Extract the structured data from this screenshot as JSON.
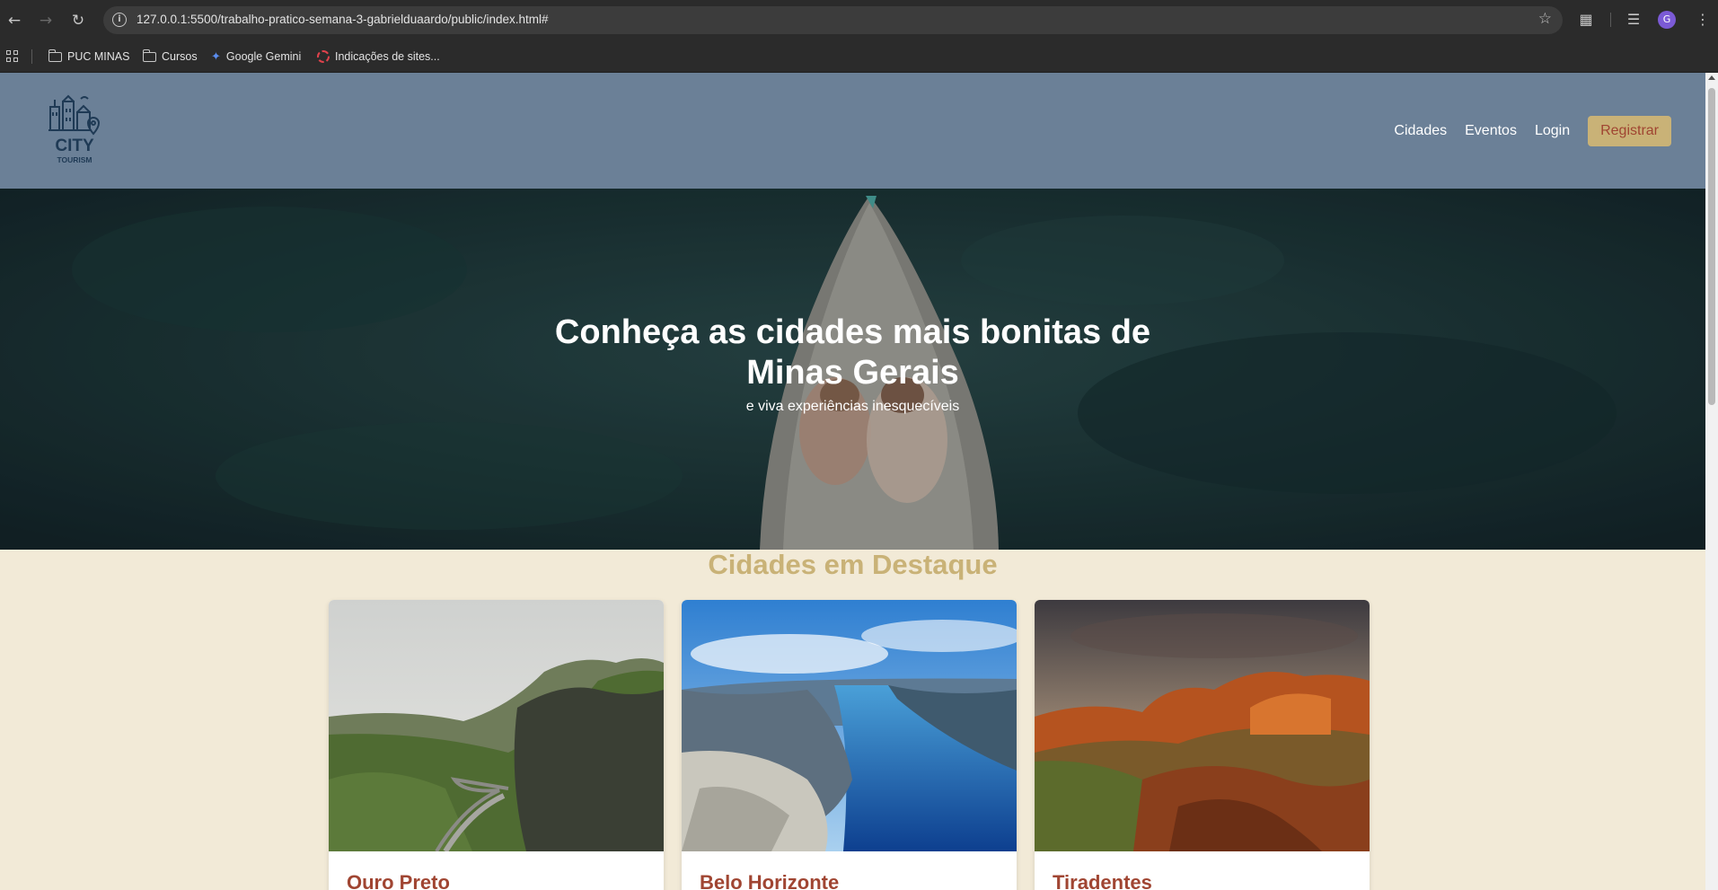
{
  "browser": {
    "url": "127.0.0.1:5500/trabalho-pratico-semana-3-gabrielduaardo/public/index.html#",
    "profile_initial": "G",
    "bookmarks": [
      {
        "label": "PUC MINAS",
        "icon": "folder-icon"
      },
      {
        "label": "Cursos",
        "icon": "folder-icon"
      },
      {
        "label": "Google Gemini",
        "icon": "gemini-icon"
      },
      {
        "label": "Indicações de sites...",
        "icon": "dashed-circle-icon"
      }
    ]
  },
  "site": {
    "logo_text": "CITY",
    "logo_subtext": "TOURISM",
    "nav": {
      "cities": "Cidades",
      "events": "Eventos",
      "login": "Login",
      "register": "Registrar"
    },
    "hero": {
      "title": "Conheça as cidades mais bonitas de Minas Gerais",
      "subtitle": "e viva experiências inesquecíveis"
    },
    "featured_title": "Cidades em Destaque",
    "cards": [
      {
        "name": "Ouro Preto"
      },
      {
        "name": "Belo Horizonte"
      },
      {
        "name": "Tiradentes"
      }
    ]
  },
  "colors": {
    "header_bg": "#6b8097",
    "page_bg": "#f2ead7",
    "accent_gold": "#c9b277",
    "accent_red": "#a04532"
  }
}
